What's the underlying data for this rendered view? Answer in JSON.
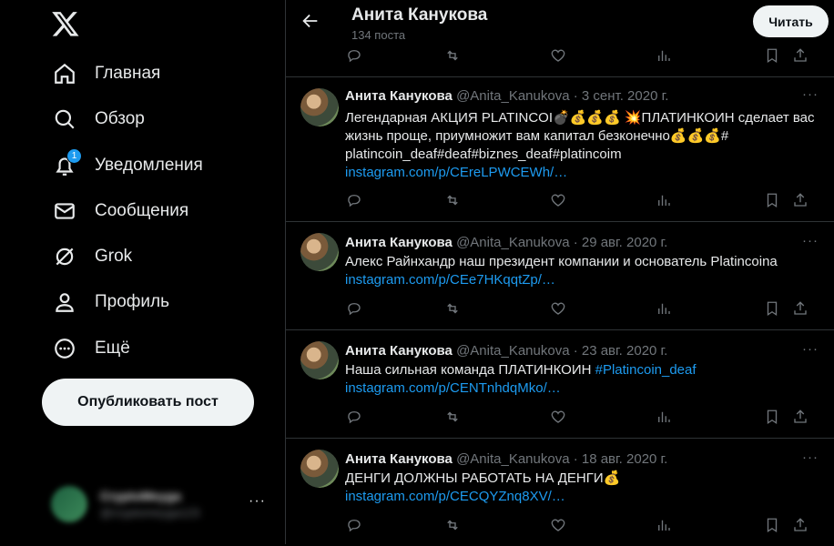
{
  "sidebar": {
    "nav": [
      {
        "label": "Главная",
        "icon": "home-icon"
      },
      {
        "label": "Обзор",
        "icon": "search-icon"
      },
      {
        "label": "Уведомления",
        "icon": "bell-icon",
        "badge": "1"
      },
      {
        "label": "Сообщения",
        "icon": "mail-icon"
      },
      {
        "label": "Grok",
        "icon": "grok-icon"
      },
      {
        "label": "Профиль",
        "icon": "person-icon"
      },
      {
        "label": "Ещё",
        "icon": "more-circle-icon"
      }
    ],
    "post_button": "Опубликовать пост",
    "account": {
      "name": "CryptoMeyga",
      "handle": "@cryptomeyga123"
    },
    "account_more": "···"
  },
  "header": {
    "title": "Анита Канукова",
    "subtitle": "134 поста",
    "follow_label": "Читать"
  },
  "tweets": [
    {
      "name": "Анита Канукова",
      "meta": "@Anita_Kanukova · 3 сент. 2020 г.",
      "lines": [
        "Легендарная АКЦИЯ PLATINCOI💣💰💰💰 💥ПЛАТИНКОИН сделает вас",
        "жизнь проще, приумножит вам капитал  безконечно💰💰💰#",
        "platincoin_deaf#deaf#biznes_deaf#platincoim"
      ],
      "link": "instagram.com/p/CEreLPWCEWh/…"
    },
    {
      "name": "Анита Канукова",
      "meta": "@Anita_Kanukova · 29 авг. 2020 г.",
      "lines": [
        "Алекс Райнхандр наш президент компании и  основатель Platincoina"
      ],
      "link": "instagram.com/p/CEe7HKqqtZp/…"
    },
    {
      "name": "Анита Канукова",
      "meta": "@Anita_Kanukova · 23 авг. 2020 г.",
      "lines": [
        "Наша сильная команда ПЛАТИНКОИН "
      ],
      "hashtag": "#Platincoin_deaf",
      "link": "instagram.com/p/CENTnhdqMko/…"
    },
    {
      "name": "Анита Канукова",
      "meta": "@Anita_Kanukova · 18 авг. 2020 г.",
      "lines": [
        "ДЕНГИ ДОЛЖНЫ РАБОТАТЬ НА ДЕНГИ💰"
      ],
      "link": "instagram.com/p/CECQYZnq8XV/…"
    }
  ],
  "tweet_more": "···",
  "colors": {
    "accent": "#1d9bf0",
    "background": "#000000",
    "text": "#e7e9ea",
    "muted": "#71767b",
    "border": "#2f3336"
  }
}
